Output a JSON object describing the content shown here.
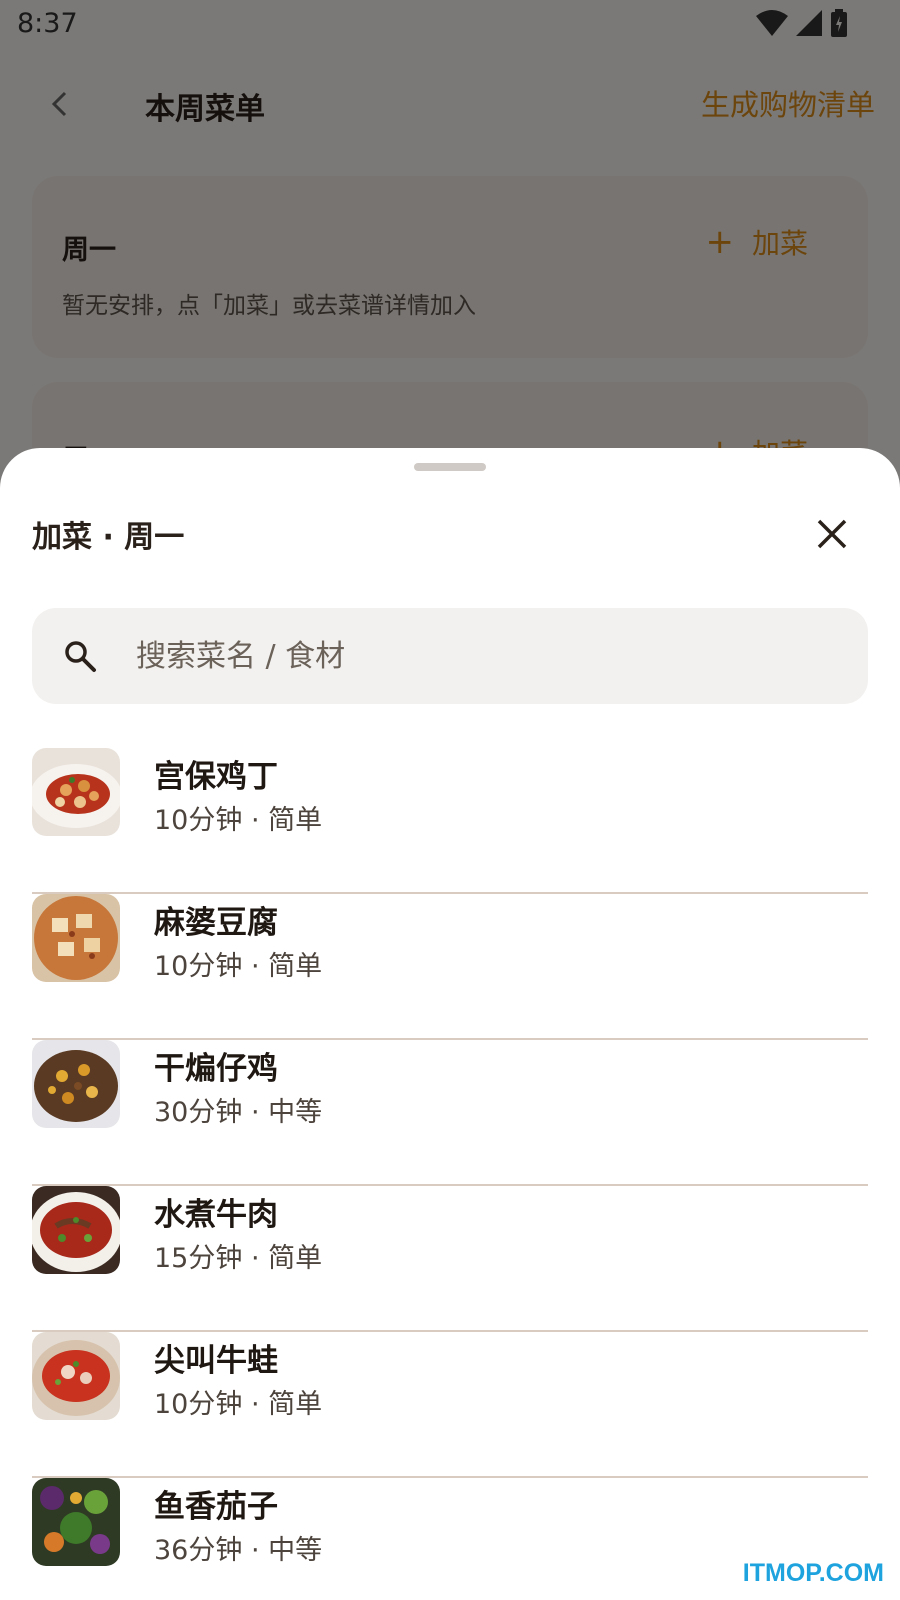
{
  "status_bar": {
    "time": "8:37"
  },
  "app_bar": {
    "title": "本周菜单",
    "shopping_list": "生成购物清单"
  },
  "days": [
    {
      "name": "周一",
      "add_label": "加菜",
      "empty_text": "暂无安排，点「加菜」或去菜谱详情加入"
    },
    {
      "name": "周二",
      "add_label": "加菜"
    }
  ],
  "sheet": {
    "title": "加菜 · 周一",
    "search_placeholder": "搜索菜名 / 食材",
    "recipes": [
      {
        "name": "宫保鸡丁",
        "meta": "10分钟 · 简单"
      },
      {
        "name": "麻婆豆腐",
        "meta": "10分钟 · 简单"
      },
      {
        "name": "干煸仔鸡",
        "meta": "30分钟 · 中等"
      },
      {
        "name": "水煮牛肉",
        "meta": "15分钟 · 简单"
      },
      {
        "name": "尖叫牛蛙",
        "meta": "10分钟 · 简单"
      },
      {
        "name": "鱼香茄子",
        "meta": "36分钟 · 中等"
      }
    ]
  },
  "watermark": "ITMOP.COM",
  "colors": {
    "accent": "#d98a1a",
    "divider": "#d9cbbf",
    "card": "#efe9e2"
  }
}
